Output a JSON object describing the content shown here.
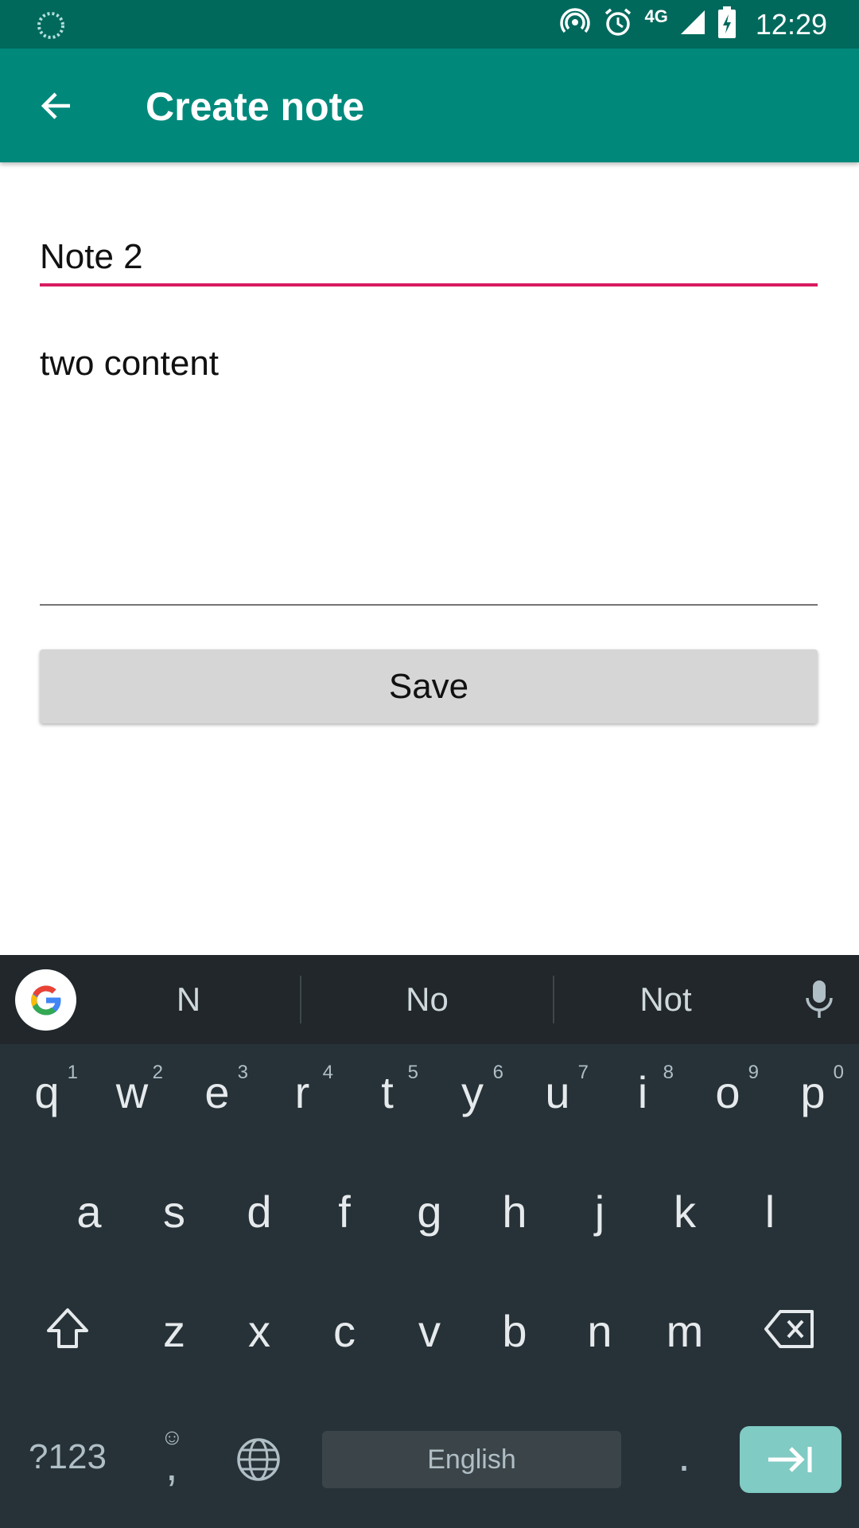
{
  "status_bar": {
    "time": "12:29",
    "network": "4G",
    "icons": [
      "spinner-icon",
      "hotspot-icon",
      "alarm-icon",
      "signal-icon",
      "battery-icon"
    ]
  },
  "app_bar": {
    "title": "Create note",
    "back_icon": "arrow-left-icon",
    "color": "#00897b"
  },
  "form": {
    "title_value": "Note 2",
    "content_value": "two content",
    "save_label": "Save",
    "accent": "#d81b60"
  },
  "keyboard": {
    "suggestions": [
      "N",
      "No",
      "Not"
    ],
    "row1": [
      {
        "k": "q",
        "h": "1"
      },
      {
        "k": "w",
        "h": "2"
      },
      {
        "k": "e",
        "h": "3"
      },
      {
        "k": "r",
        "h": "4"
      },
      {
        "k": "t",
        "h": "5"
      },
      {
        "k": "y",
        "h": "6"
      },
      {
        "k": "u",
        "h": "7"
      },
      {
        "k": "i",
        "h": "8"
      },
      {
        "k": "o",
        "h": "9"
      },
      {
        "k": "p",
        "h": "0"
      }
    ],
    "row2": [
      "a",
      "s",
      "d",
      "f",
      "g",
      "h",
      "j",
      "k",
      "l"
    ],
    "row3": [
      "z",
      "x",
      "c",
      "v",
      "b",
      "n",
      "m"
    ],
    "symbols_label": "?123",
    "comma_label": ",",
    "period_label": ".",
    "space_label": "English"
  }
}
